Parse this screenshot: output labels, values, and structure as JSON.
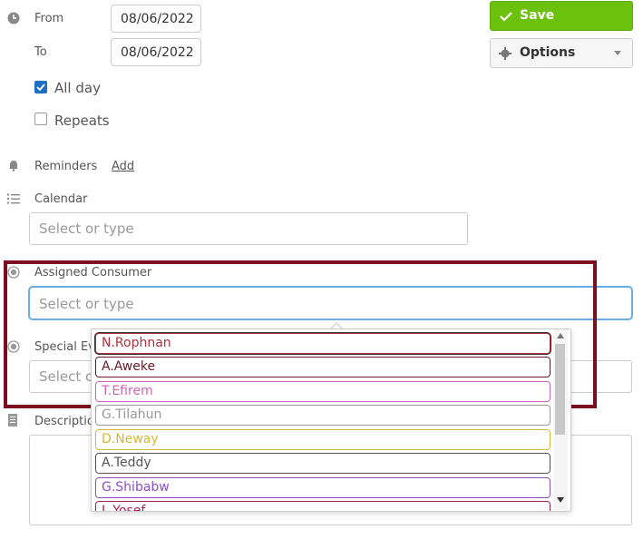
{
  "time": {
    "from_label": "From",
    "from_value": "08/06/2022",
    "to_label": "To",
    "to_value": "08/06/2022"
  },
  "all_day": {
    "label": "All day",
    "checked": true
  },
  "repeats": {
    "label": "Repeats",
    "checked": false
  },
  "reminders": {
    "label": "Reminders",
    "add_link": "Add"
  },
  "calendar": {
    "label": "Calendar",
    "placeholder": "Select or type"
  },
  "assigned_consumer": {
    "label": "Assigned Consumer",
    "placeholder": "Select or type"
  },
  "special_events": {
    "label_visible": "Special Ev",
    "placeholder_visible": "Select o"
  },
  "description": {
    "label_visible": "Descriptio"
  },
  "actions": {
    "save": "Save",
    "options": "Options"
  },
  "dropdown": {
    "options": [
      {
        "label": "N.Rophnan",
        "color": "#b03040"
      },
      {
        "label": "A.Aweke",
        "color": "#6b1a2a"
      },
      {
        "label": "T.Efirem",
        "color": "#d065b5"
      },
      {
        "label": "G.Tilahun",
        "color": "#999999"
      },
      {
        "label": "D.Neway",
        "color": "#d4b838"
      },
      {
        "label": "A.Teddy",
        "color": "#555555"
      },
      {
        "label": "G.Shibabw",
        "color": "#8c50c0"
      },
      {
        "label": "L.Yosef",
        "color": "#a0205a"
      }
    ]
  },
  "colors": {
    "save_bg": "#6cc10c",
    "focus_border": "#6aaee4",
    "highlight_border": "#7a0f20"
  }
}
